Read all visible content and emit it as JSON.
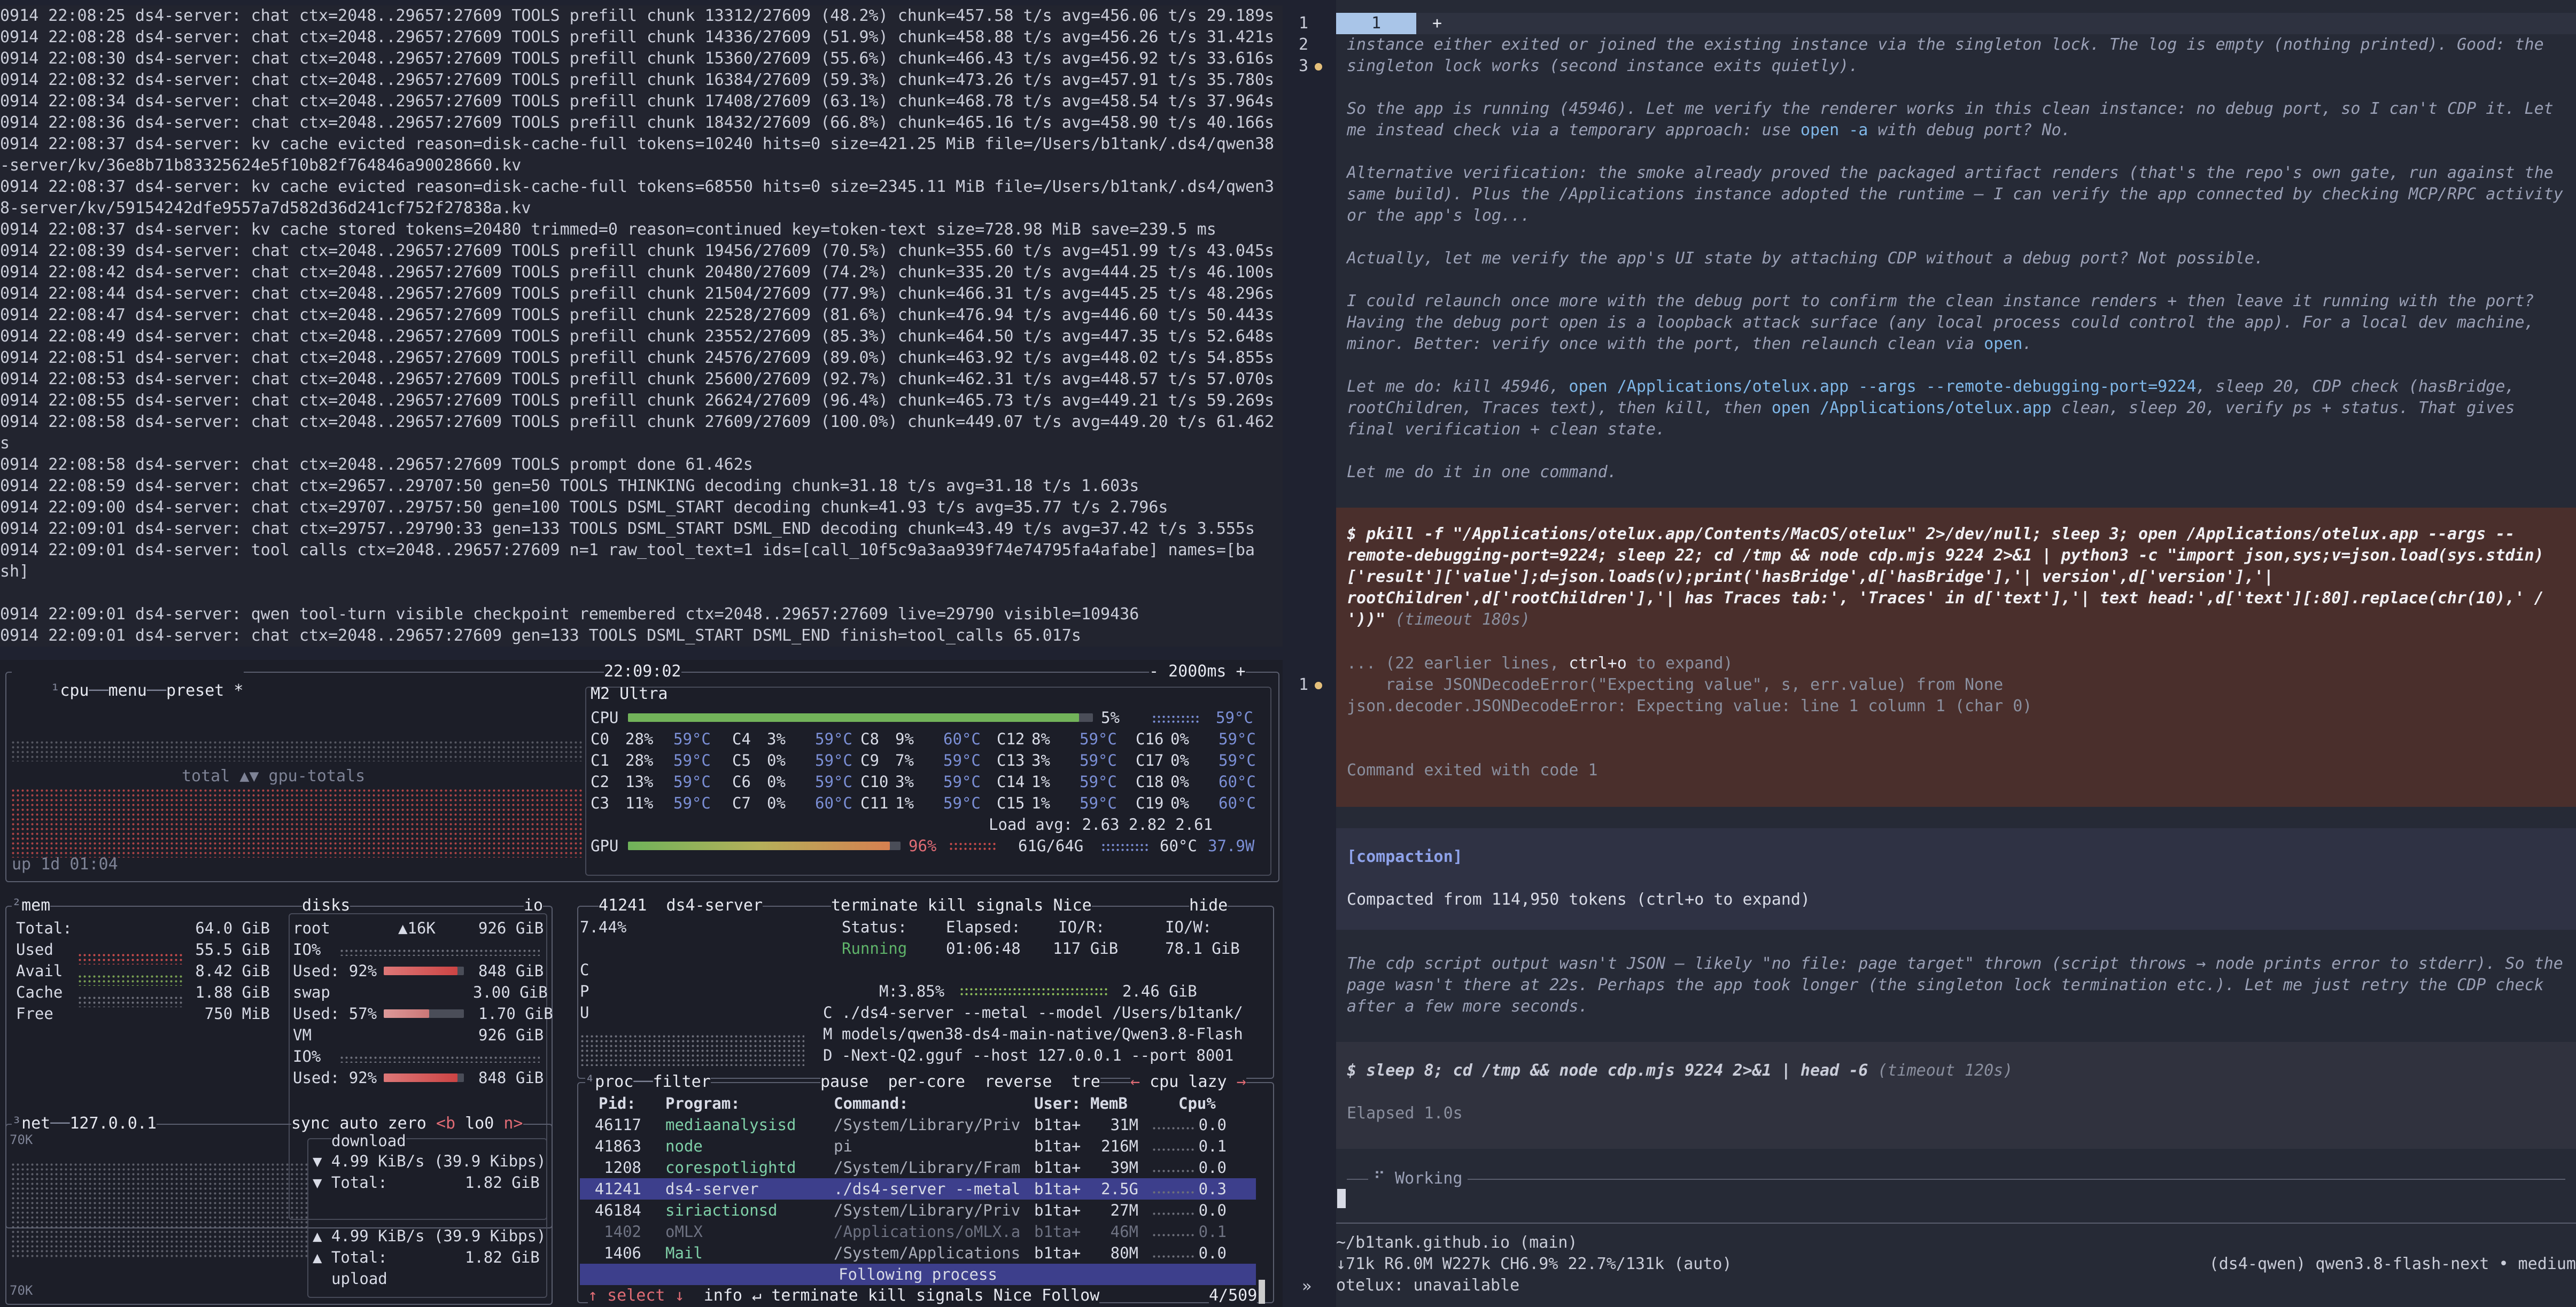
{
  "log_pane": {
    "lines": [
      "0914 22:08:25 ds4-server: chat ctx=2048..29657:27609 TOOLS prefill chunk 13312/27609 (48.2%) chunk=457.58 t/s avg=456.06 t/s 29.189s",
      "0914 22:08:28 ds4-server: chat ctx=2048..29657:27609 TOOLS prefill chunk 14336/27609 (51.9%) chunk=458.88 t/s avg=456.26 t/s 31.421s",
      "0914 22:08:30 ds4-server: chat ctx=2048..29657:27609 TOOLS prefill chunk 15360/27609 (55.6%) chunk=466.43 t/s avg=456.92 t/s 33.616s",
      "0914 22:08:32 ds4-server: chat ctx=2048..29657:27609 TOOLS prefill chunk 16384/27609 (59.3%) chunk=473.26 t/s avg=457.91 t/s 35.780s",
      "0914 22:08:34 ds4-server: chat ctx=2048..29657:27609 TOOLS prefill chunk 17408/27609 (63.1%) chunk=468.78 t/s avg=458.54 t/s 37.964s",
      "0914 22:08:36 ds4-server: chat ctx=2048..29657:27609 TOOLS prefill chunk 18432/27609 (66.8%) chunk=465.16 t/s avg=458.90 t/s 40.166s",
      "0914 22:08:37 ds4-server: kv cache evicted reason=disk-cache-full tokens=10240 hits=0 size=421.25 MiB file=/Users/b1tank/.ds4/qwen38",
      "-server/kv/36e8b71b83325624e5f10b82f764846a90028660.kv",
      "0914 22:08:37 ds4-server: kv cache evicted reason=disk-cache-full tokens=68550 hits=0 size=2345.11 MiB file=/Users/b1tank/.ds4/qwen3",
      "8-server/kv/59154242dfe9557a7d582d36d241cf752f27838a.kv",
      "0914 22:08:37 ds4-server: kv cache stored tokens=20480 trimmed=0 reason=continued key=token-text size=728.98 MiB save=239.5 ms",
      "0914 22:08:39 ds4-server: chat ctx=2048..29657:27609 TOOLS prefill chunk 19456/27609 (70.5%) chunk=355.60 t/s avg=451.99 t/s 43.045s",
      "0914 22:08:42 ds4-server: chat ctx=2048..29657:27609 TOOLS prefill chunk 20480/27609 (74.2%) chunk=335.20 t/s avg=444.25 t/s 46.100s",
      "0914 22:08:44 ds4-server: chat ctx=2048..29657:27609 TOOLS prefill chunk 21504/27609 (77.9%) chunk=466.31 t/s avg=445.25 t/s 48.296s",
      "0914 22:08:47 ds4-server: chat ctx=2048..29657:27609 TOOLS prefill chunk 22528/27609 (81.6%) chunk=476.94 t/s avg=446.60 t/s 50.443s",
      "0914 22:08:49 ds4-server: chat ctx=2048..29657:27609 TOOLS prefill chunk 23552/27609 (85.3%) chunk=464.50 t/s avg=447.35 t/s 52.648s",
      "0914 22:08:51 ds4-server: chat ctx=2048..29657:27609 TOOLS prefill chunk 24576/27609 (89.0%) chunk=463.92 t/s avg=448.02 t/s 54.855s",
      "0914 22:08:53 ds4-server: chat ctx=2048..29657:27609 TOOLS prefill chunk 25600/27609 (92.7%) chunk=462.31 t/s avg=448.57 t/s 57.070s",
      "0914 22:08:55 ds4-server: chat ctx=2048..29657:27609 TOOLS prefill chunk 26624/27609 (96.4%) chunk=465.73 t/s avg=449.21 t/s 59.269s",
      "0914 22:08:58 ds4-server: chat ctx=2048..29657:27609 TOOLS prefill chunk 27609/27609 (100.0%) chunk=449.07 t/s avg=449.20 t/s 61.462",
      "s",
      "0914 22:08:58 ds4-server: chat ctx=2048..29657:27609 TOOLS prompt done 61.462s",
      "0914 22:08:59 ds4-server: chat ctx=29657..29707:50 gen=50 TOOLS THINKING decoding chunk=31.18 t/s avg=31.18 t/s 1.603s",
      "0914 22:09:00 ds4-server: chat ctx=29707..29757:50 gen=100 TOOLS DSML_START decoding chunk=41.93 t/s avg=35.77 t/s 2.796s",
      "0914 22:09:01 ds4-server: chat ctx=29757..29790:33 gen=133 TOOLS DSML_START DSML_END decoding chunk=43.49 t/s avg=37.42 t/s 3.555s",
      "0914 22:09:01 ds4-server: tool calls ctx=2048..29657:27609 n=1 raw_tool_text=1 ids=[call_10f5c9a3aa939f74e74795fa4afabe] names=[ba",
      "sh]",
      "",
      "0914 22:09:01 ds4-server: qwen tool-turn visible checkpoint remembered ctx=2048..29657:27609 live=29790 visible=109436",
      "0914 22:09:01 ds4-server: chat ctx=2048..29657:27609 gen=133 TOOLS DSML_START DSML_END finish=tool_calls 65.017s"
    ]
  },
  "btop": {
    "header": {
      "num": "¹",
      "cpu": "cpu",
      "menu": "menu",
      "preset": "preset *",
      "time": "22:09:02",
      "refresh": "- 2000ms +"
    },
    "cpu_box": {
      "model": "M2 Ultra",
      "graph_label": "total ▲▼ gpu-totals",
      "uptime": "up 1d 01:04",
      "cpu_total": {
        "label": "CPU",
        "pct": "5%",
        "temp": "59°C",
        "fill": 0.05
      },
      "cores": [
        [
          "C0",
          "28%",
          "59°C",
          "C4",
          "3%",
          "59°C",
          "C8",
          "9%",
          "60°C",
          "C12",
          "8%",
          "59°C",
          "C16",
          "0%",
          "59°C"
        ],
        [
          "C1",
          "28%",
          "59°C",
          "C5",
          "0%",
          "59°C",
          "C9",
          "7%",
          "59°C",
          "C13",
          "3%",
          "59°C",
          "C17",
          "0%",
          "59°C"
        ],
        [
          "C2",
          "13%",
          "59°C",
          "C6",
          "0%",
          "59°C",
          "C10",
          "3%",
          "59°C",
          "C14",
          "1%",
          "59°C",
          "C18",
          "0%",
          "60°C"
        ],
        [
          "C3",
          "11%",
          "59°C",
          "C7",
          "0%",
          "60°C",
          "C11",
          "1%",
          "59°C",
          "C15",
          "1%",
          "59°C",
          "C19",
          "0%",
          "60°C"
        ]
      ],
      "load_avg": "Load avg: 2.63 2.82 2.61",
      "gpu": {
        "label": "GPU",
        "pct": "96%",
        "mem": "61G/64G",
        "temp": "60°C",
        "power": "37.9W",
        "fill": 0.96
      }
    },
    "mem_box": {
      "title": "mem",
      "rows": [
        {
          "k": "Total:",
          "v": "64.0 GiB"
        },
        {
          "k": "Used",
          "v": "55.5 GiB"
        },
        {
          "k": "Avail",
          "v": "8.42 GiB"
        },
        {
          "k": "Cache",
          "v": "1.88 GiB"
        },
        {
          "k": "Free",
          "v": "750 MiB"
        }
      ],
      "disks_title": "disks",
      "io_title": "io",
      "root": {
        "name": "root",
        "speed": "▲16K",
        "size": "926 GiB",
        "io": "IO%",
        "used": "Used: 92%",
        "used_sz": "848 GiB",
        "fill": 0.92
      },
      "swap": {
        "name": "swap",
        "size": "3.00 GiB",
        "used": "Used: 57%",
        "used_sz": "1.70 GiB",
        "fill": 0.57
      },
      "vm": {
        "name": "VM",
        "size": "926 GiB",
        "io": "IO%",
        "used": "Used: 92%",
        "used_sz": "848 GiB",
        "fill": 0.92
      }
    },
    "net_box": {
      "title": "net",
      "iface": "127.0.0.1",
      "sync": "sync",
      "auto": "auto",
      "zero": "zero",
      "prev": "<b",
      "dev": "lo0",
      "next": "n>",
      "scale_top": "70K",
      "scale_bot": "70K",
      "download": "download",
      "dl_rate": "▼ 4.99 KiB/s (39.9 Kibps)",
      "dl_total": "▼ Total:",
      "dl_total_v": "1.82 GiB",
      "ul_rate": "▲ 4.99 KiB/s (39.9 Kibps)",
      "ul_total": "▲ Total:",
      "ul_total_v": "1.82 GiB",
      "upload": "upload"
    },
    "proc_detail": {
      "pid": "41241",
      "name": "ds4-server",
      "cpu": "7.44%",
      "terminate": "terminate",
      "kill": "kill",
      "signals": "signals",
      "nice": "Nice",
      "hide": "hide",
      "status_k": "Status:",
      "status_v": "Running",
      "elapsed_k": "Elapsed:",
      "elapsed_v": "01:06:48",
      "ior_k": "IO/R:",
      "ior_v": "117 GiB",
      "iow_k": "IO/W:",
      "iow_v": "78.1 GiB",
      "mem": "M:3.85%",
      "mem_v": "2.46 GiB",
      "letters": [
        "C",
        "P",
        "U"
      ],
      "cmd_lines": [
        "C ./ds4-server --metal --model /Users/b1tank/",
        "M models/qwen38-ds4-main-native/Qwen3.8-Flash",
        "D -Next-Q2.gguf --host 127.0.0.1 --port 8001"
      ]
    },
    "proc_box": {
      "title": "proc",
      "filter": "filter",
      "pause": "pause",
      "per_core": "per-core",
      "reverse": "reverse",
      "tree": "tre",
      "sort": "cpu lazy",
      "headers": [
        "Pid:",
        "Program:",
        "Command:",
        "User:",
        "MemB",
        "Cpu%"
      ],
      "rows": [
        [
          "46117",
          "mediaanalysisd",
          "/System/Library/Priv",
          "b1ta+",
          "31M",
          "0.0"
        ],
        [
          "41863",
          "node",
          "pi",
          "b1ta+",
          "216M",
          "0.1"
        ],
        [
          "1208",
          "corespotlightd",
          "/System/Library/Fram",
          "b1ta+",
          "39M",
          "0.0"
        ],
        [
          "41241",
          "ds4-server",
          "./ds4-server --metal",
          "b1ta+",
          "2.5G",
          "0.3"
        ],
        [
          "46184",
          "siriactionsd",
          "/System/Library/Priv",
          "b1ta+",
          "27M",
          "0.0"
        ],
        [
          "1402",
          "oMLX",
          "/Applications/oMLX.a",
          "b1ta+",
          "46M",
          "0.1"
        ],
        [
          "1406",
          "Mail",
          "/System/Applications",
          "b1ta+",
          "80M",
          "0.0"
        ]
      ],
      "following": "Following process",
      "footer": [
        "↑ select ↓",
        "info ↵",
        "terminate",
        "kill",
        "signals",
        "Nice",
        "Follow"
      ],
      "count": "4/509"
    }
  },
  "divider_glyph": "»",
  "right_pane": {
    "tabs": {
      "active": "1",
      "plus": "+"
    },
    "line_nums": [
      "1",
      "2",
      "3"
    ],
    "para1": "instance either exited or joined the existing instance via the singleton lock. The log is empty (nothing printed). Good: the singleton lock works (second instance exits quietly).",
    "para2_a": "So the app is running (45946). Let me verify the renderer works in this clean instance: no debug port, so I can't CDP it. Let me instead check via a temporary approach: use ",
    "para2_code": "open -a",
    "para2_b": " with debug port? No.",
    "para3": "Alternative verification: the smoke already proved the packaged artifact renders (that's the repo's own gate, run against the same build). Plus the /Applications instance adopted the runtime — I can verify the app connected by checking MCP/RPC activity or the app's log...",
    "para4": "Actually, let me verify the app's UI state by attaching CDP without a debug port? Not possible.",
    "para5_a": "I could relaunch once more with the debug port to confirm the clean instance renders + then leave it running with the port? Having the debug port open is a loopback attack surface (any local process could control the app). For a local dev machine, minor. Better: verify once with the port, then relaunch clean via ",
    "para5_code": "open",
    "para5_b": ".",
    "para6_a": "Let me do: kill 45946, ",
    "para6_code1": "open /Applications/otelux.app --args --remote-debugging-port=9224",
    "para6_b": ", sleep 20, CDP check (hasBridge, rootChildren, Traces text), then kill, then ",
    "para6_code2": "open /Applications/otelux.app",
    "para6_c": " clean, sleep 20, verify ps + status. That gives final verification + clean state.",
    "para7": "Let me do it in one command.",
    "cmd1": "$ pkill -f \"/Applications/otelux.app/Contents/MacOS/otelux\" 2>/dev/null; sleep 3; open /Applications/otelux.app --args --remote-debugging-port=9224; sleep 22; cd /tmp && node cdp.mjs 9224 2>&1 | python3 -c \"import json,sys;v=json.load(sys.stdin)['result']['value'];d=json.loads(v);print('hasBridge',d['hasBridge'],'| version',d['version'],'| rootChildren',d['rootChildren'],'| has Traces tab:', 'Traces' in d['text'],'| text head:',d['text'][:80].replace(chr(10),' / '))\"",
    "cmd1_timeout": "(timeout 180s)",
    "out1_a": "... (22 earlier lines, ",
    "out1_key": "ctrl+o",
    "out1_b": " to expand)",
    "out1_2": "    raise JSONDecodeError(\"Expecting value\", s, err.value) from None",
    "out1_3": "json.decoder.JSONDecodeError: Expecting value: line 1 column 1 (char 0)",
    "out1_exit": "Command exited with code 1",
    "compaction_title": "[compaction]",
    "compaction_text": "Compacted from 114,950 tokens (ctrl+o to expand)",
    "para8": "The cdp script output wasn't JSON — likely \"no file: page target\" thrown (script throws → node prints error to stderr). So the page wasn't there at 22s. Perhaps the app took longer (the singleton lock termination etc.). Let me just retry the CDP check after a few more seconds.",
    "cmd2": "$ sleep 8; cd /tmp && node cdp.mjs 9224 2>&1 | head -6",
    "cmd2_timeout": "(timeout 120s)",
    "elapsed": "Elapsed 1.0s",
    "working": "⠋ Working",
    "path": "~/b1tank.github.io (main)",
    "stats": "↓71k R6.0M W227k CH6.9% 22.7%/131k (auto)",
    "model": "(ds4-qwen) qwen3.8-flash-next • medium",
    "otelux": "otelux: unavailable",
    "side_num": "1"
  }
}
